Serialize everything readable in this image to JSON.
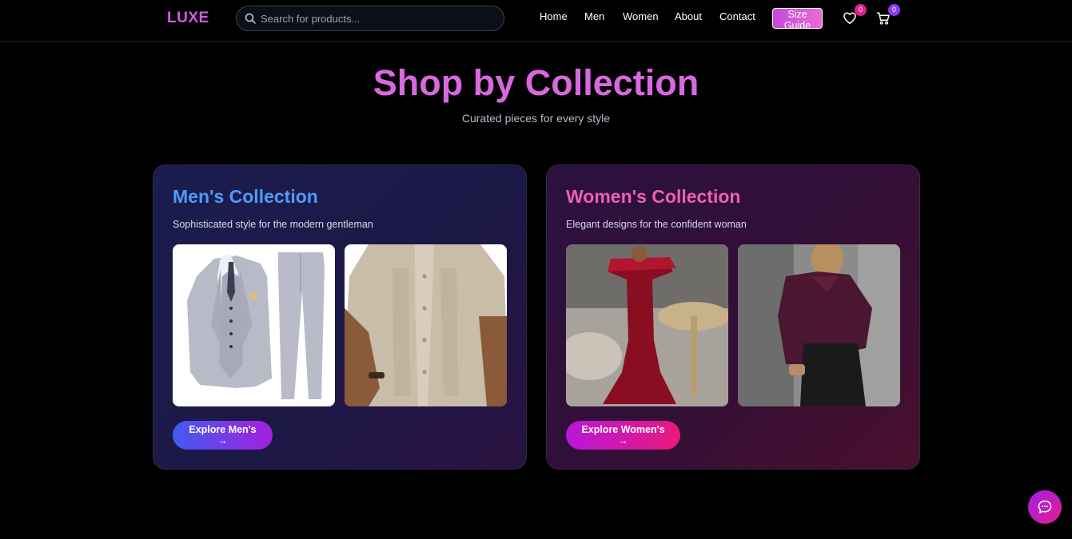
{
  "header": {
    "logo": "LUXE",
    "search": {
      "placeholder": "Search for products..."
    },
    "nav": [
      "Home",
      "Men",
      "Women",
      "About",
      "Contact"
    ],
    "size_guide": "Size Guide",
    "wishlist_count": "0",
    "cart_count": "0"
  },
  "hero": {
    "title": "Shop by Collection",
    "subtitle": "Curated pieces for every style"
  },
  "collections": [
    {
      "title": "Men's Collection",
      "description": "Sophisticated style for the modern gentleman",
      "cta": "Explore Men's →",
      "images": [
        "grey-three-piece-suit",
        "beige-embroidered-shirt"
      ]
    },
    {
      "title": "Women's Collection",
      "description": "Elegant designs for the confident woman",
      "cta": "Explore Women's →",
      "images": [
        "red-mermaid-gown",
        "burgundy-satin-blouse"
      ]
    }
  ],
  "colors": {
    "logo": "#d05ce3",
    "title": "#d968e0",
    "men_accent": "#4f9cf9",
    "women_accent": "#ef5fb2",
    "wishlist_badge": "#e0238a",
    "cart_badge": "#8b3cf7"
  },
  "icons": {
    "search": "search-icon",
    "wishlist": "heart-icon",
    "cart": "cart-icon",
    "chat": "chat-icon"
  }
}
